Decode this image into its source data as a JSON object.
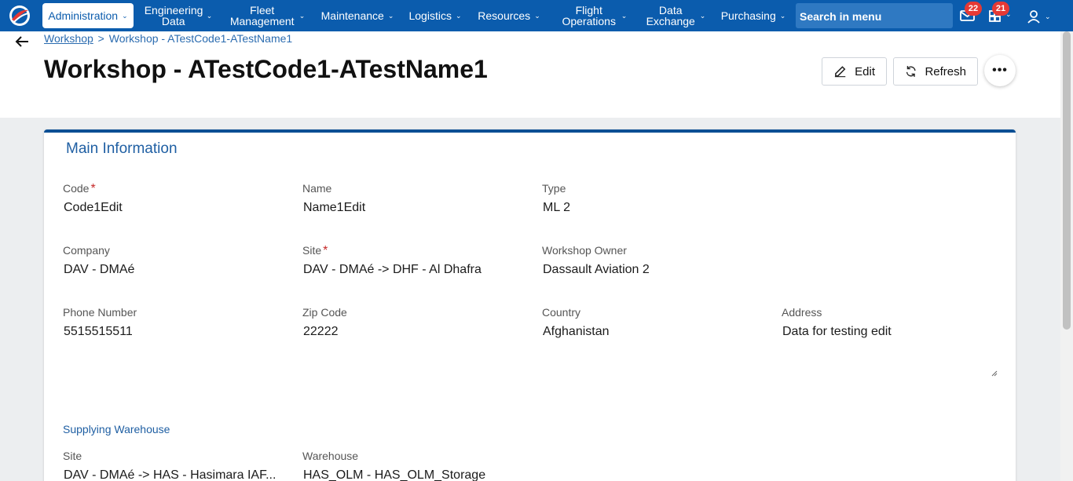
{
  "nav": {
    "items": [
      {
        "label": "Administration",
        "active": true
      },
      {
        "label": "Engineering Data"
      },
      {
        "label": "Fleet Management"
      },
      {
        "label": "Maintenance"
      },
      {
        "label": "Logistics"
      },
      {
        "label": "Resources"
      },
      {
        "label": "Flight Operations"
      },
      {
        "label": "Data Exchange"
      },
      {
        "label": "Purchasing"
      }
    ],
    "search_placeholder": "Search in menu",
    "messages_badge": "22",
    "tasks_badge": "21",
    "chevron": "⌄",
    "colors": {
      "bar": "#0b5cad",
      "badge": "#e53935"
    }
  },
  "header": {
    "breadcrumb_root": "Workshop",
    "breadcrumb_separator": ">",
    "breadcrumb_current": "Workshop - ATestCode1-ATestName1",
    "title": "Workshop - ATestCode1-ATestName1",
    "edit_label": "Edit",
    "refresh_label": "Refresh",
    "more_label": "•••"
  },
  "main": {
    "section_title": "Main Information",
    "fields": {
      "code": {
        "label": "Code",
        "value": "Code1Edit",
        "required": true
      },
      "name": {
        "label": "Name",
        "value": "Name1Edit"
      },
      "type": {
        "label": "Type",
        "value": "ML 2"
      },
      "company": {
        "label": "Company",
        "value": "DAV - DMAé"
      },
      "site": {
        "label": "Site",
        "value": "DAV - DMAé -> DHF - Al Dhafra",
        "required": true
      },
      "owner": {
        "label": "Workshop Owner",
        "value": "Dassault Aviation 2"
      },
      "phone": {
        "label": "Phone Number",
        "value": "5515515511"
      },
      "zip": {
        "label": "Zip Code",
        "value": "22222"
      },
      "country": {
        "label": "Country",
        "value": "Afghanistan"
      },
      "address": {
        "label": "Address",
        "value": "Data for testing edit"
      }
    },
    "required_mark": "*",
    "supplying_title": "Supplying Warehouse",
    "supplying": {
      "site": {
        "label": "Site",
        "value": "DAV - DMAé -> HAS - Hasimara IAF..."
      },
      "warehouse": {
        "label": "Warehouse",
        "value": "HAS_OLM - HAS_OLM_Storage"
      }
    }
  }
}
